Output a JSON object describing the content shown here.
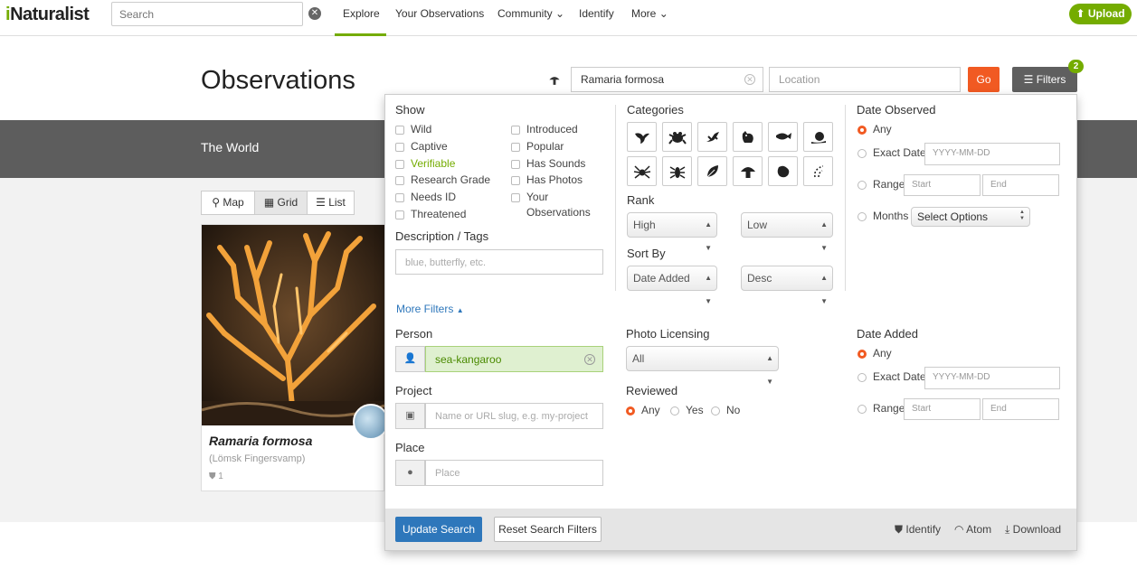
{
  "nav": {
    "logo_i": "i",
    "logo_rest": "Naturalist",
    "search_placeholder": "Search",
    "links": [
      "Explore",
      "Your Observations",
      "Community",
      "Identify",
      "More"
    ],
    "upload_label": "Upload"
  },
  "header": {
    "title": "Observations",
    "taxon_value": "Ramaria formosa",
    "location_placeholder": "Location",
    "go_label": "Go",
    "filters_label": "Filters",
    "filters_count": "2",
    "place_name": "The World"
  },
  "views": {
    "map": "Map",
    "grid": "Grid",
    "list": "List",
    "active": "grid"
  },
  "card": {
    "scientific_name": "Ramaria formosa",
    "common_name": "(Lömsk Fingersvamp)",
    "count": "1"
  },
  "filters": {
    "show_heading": "Show",
    "show_col1": [
      "Wild",
      "Captive",
      "Verifiable",
      "Research Grade",
      "Needs ID",
      "Threatened"
    ],
    "show_col2": [
      "Introduced",
      "Popular",
      "Has Sounds",
      "Has Photos",
      "Your",
      "Observations"
    ],
    "description_heading": "Description / Tags",
    "description_placeholder": "blue, butterfly, etc.",
    "categories_heading": "Categories",
    "category_icons": [
      "bird-icon",
      "amphibian-icon",
      "reptile-icon",
      "mammal-icon",
      "fish-icon",
      "mollusk-icon",
      "spider-icon",
      "insect-icon",
      "plant-icon",
      "fungus-icon",
      "protozoa-icon",
      "unknown-icon"
    ],
    "rank_heading": "Rank",
    "rank_high": "High",
    "rank_low": "Low",
    "sort_heading": "Sort By",
    "sort_field": "Date Added",
    "sort_order": "Desc",
    "date_observed_heading": "Date Observed",
    "date_any": "Any",
    "date_exact": "Exact Date",
    "date_placeholder": "YYYY-MM-DD",
    "date_range": "Range",
    "start_placeholder": "Start",
    "end_placeholder": "End",
    "months": "Months",
    "months_select": "Select Options",
    "more_filters": "More Filters",
    "person_heading": "Person",
    "person_value": "sea-kangaroo",
    "project_heading": "Project",
    "project_placeholder": "Name or URL slug, e.g. my-project",
    "place_heading": "Place",
    "place_placeholder": "Place",
    "photo_licensing_heading": "Photo Licensing",
    "photo_licensing_value": "All",
    "reviewed_heading": "Reviewed",
    "reviewed_any": "Any",
    "reviewed_yes": "Yes",
    "reviewed_no": "No",
    "date_added_heading": "Date Added",
    "update_search": "Update Search",
    "reset_filters": "Reset Search Filters",
    "identify_link": "Identify",
    "atom_link": "Atom",
    "download_link": "Download"
  },
  "colors": {
    "brand_green": "#74ac00",
    "accent_orange": "#f15a22",
    "button_blue": "#2e77bb"
  }
}
